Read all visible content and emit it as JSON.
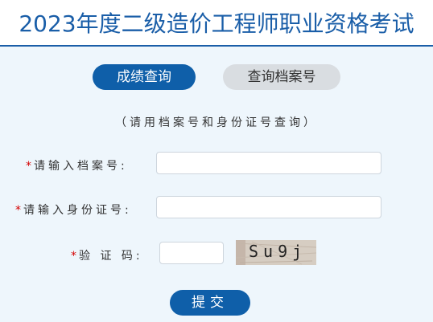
{
  "header": {
    "title": "2023年度二级造价工程师职业资格考试"
  },
  "tabs": {
    "active_label": "成绩查询",
    "inactive_label": "查询档案号"
  },
  "hint": "（请用档案号和身份证号查询）",
  "form": {
    "archive_required_mark": "*",
    "archive_label": "请输入档案号:",
    "archive_value": "",
    "id_required_mark": "*",
    "id_label": "请输入身份证号:",
    "id_value": "",
    "captcha_required_mark": "*",
    "captcha_label": "验 证 码:",
    "captcha_value": "",
    "captcha_image_text": "Su9j"
  },
  "submit_label": "提交",
  "colors": {
    "brand_blue": "#0f5fa9",
    "content_bg": "#eef6fc",
    "required_red": "#d40000"
  }
}
